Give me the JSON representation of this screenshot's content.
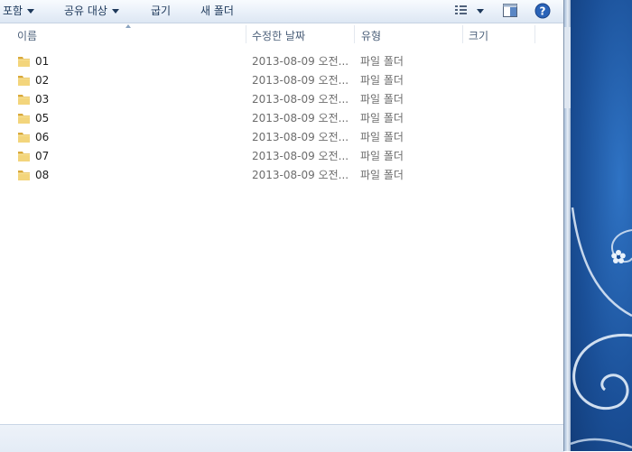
{
  "toolbar": {
    "include_label": "포함",
    "share_label": "공유 대상",
    "burn_label": "굽기",
    "new_folder_label": "새 폴더"
  },
  "columns": {
    "name": "이름",
    "date_modified": "수정한 날짜",
    "type": "유형",
    "size": "크기"
  },
  "files": [
    {
      "name": "01",
      "date": "2013-08-09 오전...",
      "type": "파일 폴더"
    },
    {
      "name": "02",
      "date": "2013-08-09 오전...",
      "type": "파일 폴더"
    },
    {
      "name": "03",
      "date": "2013-08-09 오전...",
      "type": "파일 폴더"
    },
    {
      "name": "05",
      "date": "2013-08-09 오전...",
      "type": "파일 폴더"
    },
    {
      "name": "06",
      "date": "2013-08-09 오전...",
      "type": "파일 폴더"
    },
    {
      "name": "07",
      "date": "2013-08-09 오전...",
      "type": "파일 폴더"
    },
    {
      "name": "08",
      "date": "2013-08-09 오전...",
      "type": "파일 폴더"
    }
  ],
  "icons": {
    "view": "view-options-icon",
    "preview_pane": "preview-pane-icon",
    "help": "help-icon",
    "folder": "folder-icon"
  },
  "colors": {
    "toolbar_text": "#1e395b",
    "secondary_text": "#6d6d6d",
    "folder_yellow": "#e9c25a",
    "desktop_blue": "#1a4f97",
    "help_blue": "#2a63b8"
  }
}
